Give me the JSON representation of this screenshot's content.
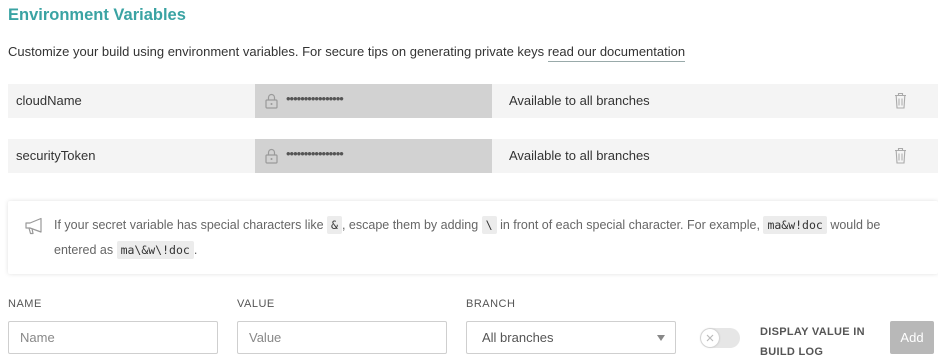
{
  "section": {
    "title": "Environment Variables",
    "description": "Customize your build using environment variables. For secure tips on generating private keys",
    "doc_link": "read our documentation"
  },
  "variables": [
    {
      "name": "cloudName",
      "masked_value": "••••••••••••••••",
      "branch": "Available to all branches"
    },
    {
      "name": "securityToken",
      "masked_value": "••••••••••••••••",
      "branch": "Available to all branches"
    }
  ],
  "note": {
    "icon": "megaphone-icon",
    "part1": "If your secret variable has special characters like",
    "code1": "&",
    "part2": ", escape them by adding",
    "code2": "\\",
    "part3": "in front of each special character. For example,",
    "code3": "ma&w!doc",
    "part4": "would be entered as",
    "code4": "ma\\&w\\!doc",
    "part5": "."
  },
  "form": {
    "name_label": "NAME",
    "name_placeholder": "Name",
    "value_label": "VALUE",
    "value_placeholder": "Value",
    "branch_label": "BRANCH",
    "branch_selected": "All branches",
    "toggle_label": "DISPLAY VALUE IN BUILD LOG",
    "toggle_on": false,
    "add_label": "Add"
  },
  "colors": {
    "title": "#3aa3a3",
    "row_bg": "#f4f4f4",
    "masked_bg": "#d2d2d2",
    "add_button_bg": "#b8b8b8"
  }
}
